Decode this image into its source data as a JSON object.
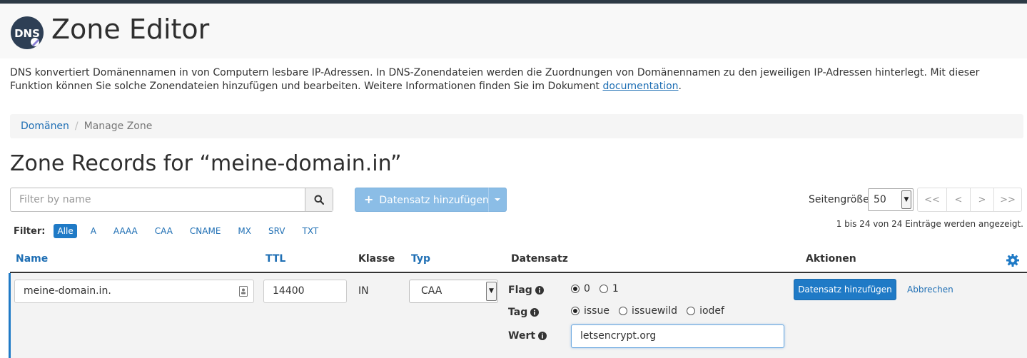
{
  "app": {
    "logo_text": "DNS",
    "title": "Zone Editor",
    "description": "DNS konvertiert Domänennamen in von Computern lesbare IP-Adressen. In DNS-Zonendateien werden die Zuordnungen von Domänennamen zu den jeweiligen IP-Adressen hinterlegt. Mit dieser Funktion können Sie solche Zonendateien hinzufügen und bearbeiten. Weitere Informationen finden Sie im Dokument",
    "doc_link": "documentation",
    "desc_end": "."
  },
  "breadcrumb": {
    "items": [
      "Domänen",
      "Manage Zone"
    ],
    "separator": "/"
  },
  "page_title": "Zone Records for “meine-domain.in”",
  "toolbar": {
    "filter_placeholder": "Filter by name",
    "add_label": "Datensatz hinzufügen",
    "page_size_label": "Seitengröße",
    "page_size_value": "50",
    "pager": [
      "<<",
      "<",
      ">",
      ">>"
    ]
  },
  "filters": {
    "label": "Filter:",
    "options": [
      "Alle",
      "A",
      "AAAA",
      "CAA",
      "CNAME",
      "MX",
      "SRV",
      "TXT"
    ],
    "active": "Alle"
  },
  "entries_info": "1 bis 24 von 24 Einträge werden angezeigt.",
  "table": {
    "headers": {
      "name": "Name",
      "ttl": "TTL",
      "klasse": "Klasse",
      "typ": "Typ",
      "datensatz": "Datensatz",
      "aktionen": "Aktionen"
    }
  },
  "edit_row": {
    "name_value": "meine-domain.in.",
    "ttl_value": "14400",
    "class_value": "IN",
    "type_value": "CAA",
    "flag": {
      "label": "Flag",
      "options": [
        "0",
        "1"
      ],
      "selected": "0"
    },
    "tag": {
      "label": "Tag",
      "options": [
        "issue",
        "issuewild",
        "iodef"
      ],
      "selected": "issue"
    },
    "wert": {
      "label": "Wert",
      "value": "letsencrypt.org"
    },
    "save_label": "Datensatz hinzufügen",
    "cancel_label": "Abbrechen"
  },
  "colors": {
    "primary": "#1f7ac6",
    "link": "#1f6fb4",
    "primary_light": "#8bbde6",
    "logo_bg": "#2e3f55"
  }
}
